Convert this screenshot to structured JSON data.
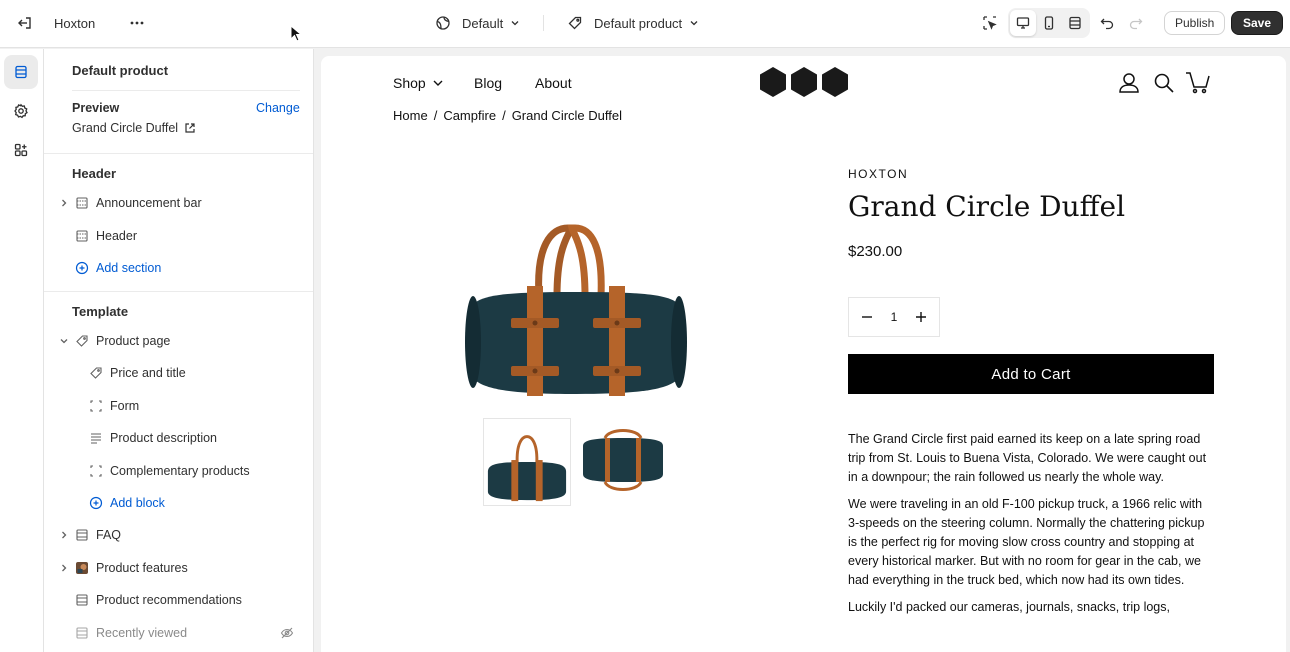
{
  "topbar": {
    "store_name": "Hoxton",
    "theme_selector": "Default",
    "template_selector": "Default product",
    "publish_label": "Publish",
    "save_label": "Save"
  },
  "sidebar": {
    "template_title": "Default product",
    "preview_label": "Preview",
    "preview_change": "Change",
    "preview_product": "Grand Circle Duffel",
    "header_group": {
      "title": "Header",
      "items": [
        {
          "label": "Announcement bar"
        },
        {
          "label": "Header"
        }
      ],
      "add_section": "Add section"
    },
    "template_group": {
      "title": "Template",
      "product_page": "Product page",
      "blocks": [
        {
          "label": "Price and title"
        },
        {
          "label": "Form"
        },
        {
          "label": "Product description"
        },
        {
          "label": "Complementary products"
        }
      ],
      "add_block": "Add block",
      "sections": [
        {
          "label": "FAQ"
        },
        {
          "label": "Product features"
        },
        {
          "label": "Product recommendations"
        },
        {
          "label": "Recently viewed"
        }
      ]
    }
  },
  "store": {
    "nav": [
      "Shop",
      "Blog",
      "About"
    ],
    "breadcrumb": [
      "Home",
      "/",
      "Campfire",
      "/",
      "Grand Circle Duffel"
    ],
    "vendor": "HOXTON",
    "title": "Grand Circle Duffel",
    "price": "$230.00",
    "quantity": "1",
    "add_to_cart": "Add to Cart",
    "description": [
      "The Grand Circle first paid earned its keep on a late spring road trip from St. Louis to Buena Vista, Colorado. We were caught out in a downpour; the rain followed us nearly the whole way.",
      "We were traveling in an old F-100 pickup truck, a 1966 relic with 3-speeds on the steering column. Normally the chattering pickup is the perfect rig for moving slow cross country and stopping at every historical marker. But with no room for gear in the cab, we had everything in the truck bed, which now had its own tides.",
      "Luckily I'd packed our cameras, journals, snacks, trip logs,"
    ]
  },
  "colors": {
    "accent_blue": "#005bd3",
    "bag_green": "#1c3a44",
    "leather": "#b5642a",
    "button_black": "#000000"
  },
  "icons": [
    "exit-icon",
    "more-icon",
    "globe-icon",
    "tag-icon",
    "chevron-down-icon",
    "inspector-icon",
    "desktop-icon",
    "mobile-icon",
    "fullwidth-icon",
    "undo-icon",
    "redo-icon",
    "sections-icon",
    "settings-icon",
    "apps-icon",
    "external-link-icon",
    "hidden-eye-icon",
    "user-icon",
    "search-icon",
    "cart-icon"
  ]
}
